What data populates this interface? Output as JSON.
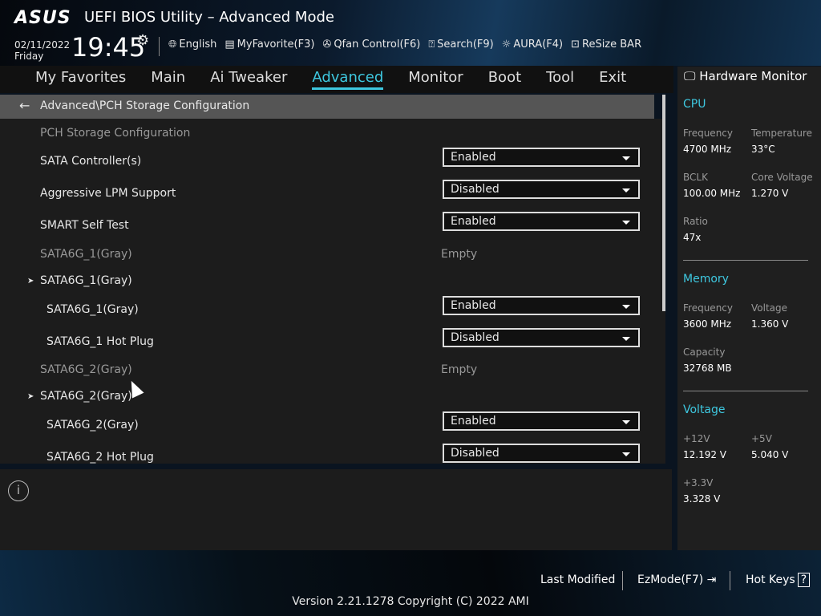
{
  "header": {
    "logo": "ASUS",
    "title": "UEFI BIOS Utility – Advanced Mode",
    "date": "02/11/2022",
    "day": "Friday",
    "time": "19:45",
    "tools": [
      {
        "icon": "globe-icon",
        "label": "English"
      },
      {
        "icon": "favorite-icon",
        "label": "MyFavorite(F3)"
      },
      {
        "icon": "fan-icon",
        "label": "Qfan Control(F6)"
      },
      {
        "icon": "search-icon",
        "label": "Search(F9)"
      },
      {
        "icon": "aura-icon",
        "label": "AURA(F4)"
      },
      {
        "icon": "resize-bar-icon",
        "label": "ReSize BAR"
      }
    ]
  },
  "nav": [
    "My Favorites",
    "Main",
    "Ai Tweaker",
    "Advanced",
    "Monitor",
    "Boot",
    "Tool",
    "Exit"
  ],
  "breadcrumb": "Advanced\\PCH Storage Configuration",
  "rows": [
    {
      "label": "PCH Storage Configuration",
      "type": "heading"
    },
    {
      "label": "SATA Controller(s)",
      "type": "select",
      "value": "Enabled"
    },
    {
      "label": "Aggressive LPM Support",
      "type": "select",
      "value": "Disabled"
    },
    {
      "label": "SMART Self Test",
      "type": "select",
      "value": "Enabled"
    },
    {
      "label": "SATA6G_1(Gray)",
      "type": "info",
      "value": "Empty"
    },
    {
      "label": "SATA6G_1(Gray)",
      "type": "submenu"
    },
    {
      "label": "SATA6G_1(Gray)",
      "type": "select",
      "value": "Enabled",
      "sub": true
    },
    {
      "label": "SATA6G_1 Hot Plug",
      "type": "select",
      "value": "Disabled",
      "sub": true
    },
    {
      "label": "SATA6G_2(Gray)",
      "type": "info",
      "value": "Empty"
    },
    {
      "label": "SATA6G_2(Gray)",
      "type": "submenu"
    },
    {
      "label": "SATA6G_2(Gray)",
      "type": "select",
      "value": "Enabled",
      "sub": true
    },
    {
      "label": "SATA6G_2 Hot Plug",
      "type": "select",
      "value": "Disabled",
      "sub": true
    }
  ],
  "hw": {
    "title": "Hardware Monitor",
    "cpu": {
      "title": "CPU",
      "frequency_label": "Frequency",
      "frequency": "4700 MHz",
      "temp_label": "Temperature",
      "temp": "33°C",
      "bclk_label": "BCLK",
      "bclk": "100.00 MHz",
      "vcore_label": "Core Voltage",
      "vcore": "1.270 V",
      "ratio_label": "Ratio",
      "ratio": "47x"
    },
    "memory": {
      "title": "Memory",
      "frequency_label": "Frequency",
      "frequency": "3600 MHz",
      "voltage_label": "Voltage",
      "voltage": "1.360 V",
      "capacity_label": "Capacity",
      "capacity": "32768 MB"
    },
    "voltage": {
      "title": "Voltage",
      "v12_label": "+12V",
      "v12": "12.192 V",
      "v5_label": "+5V",
      "v5": "5.040 V",
      "v33_label": "+3.3V",
      "v33": "3.328 V"
    }
  },
  "footer": {
    "last_modified": "Last Modified",
    "ezmode": "EzMode(F7)",
    "hotkeys": "Hot Keys",
    "version": "Version 2.21.1278 Copyright (C) 2022 AMI"
  }
}
